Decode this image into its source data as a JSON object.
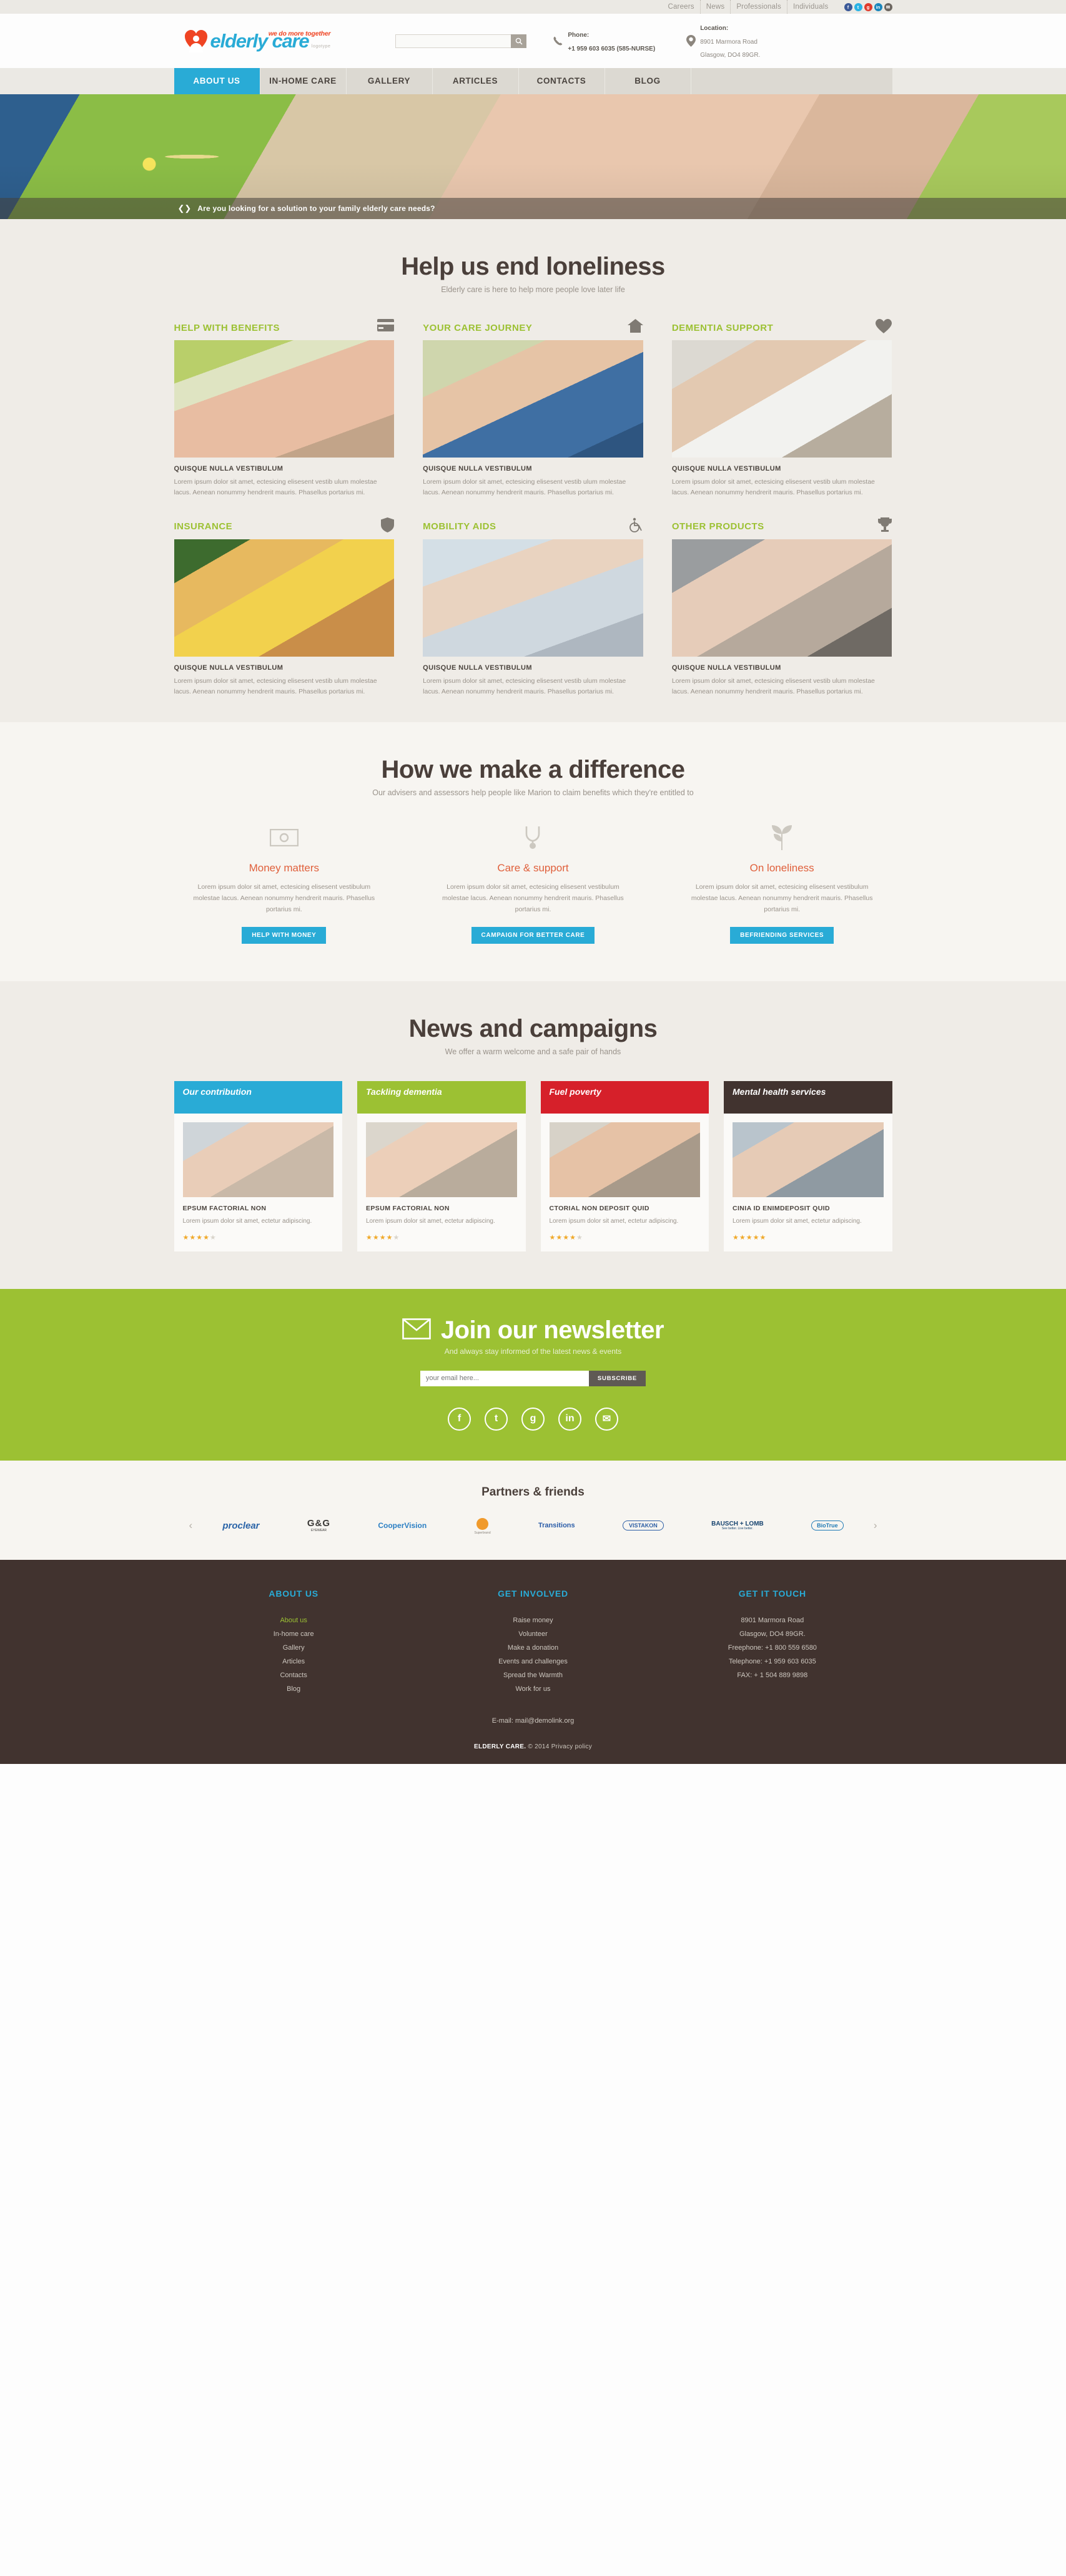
{
  "topbar": {
    "links": [
      "Careers",
      "News",
      "Professionals",
      "Individuals"
    ],
    "social": [
      {
        "name": "facebook-icon",
        "glyph": "f"
      },
      {
        "name": "twitter-icon",
        "glyph": "t"
      },
      {
        "name": "google-plus-icon",
        "glyph": "g"
      },
      {
        "name": "linkedin-icon",
        "glyph": "in"
      },
      {
        "name": "mail-icon",
        "glyph": "✉"
      }
    ]
  },
  "header": {
    "logo_main": "elderly care",
    "logo_tagline": "we do more together",
    "logo_sub": "logotype",
    "search_placeholder": "",
    "search_value": "",
    "phone_label": "Phone:",
    "phone_value": "+1 959 603 6035 (585-NURSE)",
    "location_label": "Location:",
    "location_line1": "8901 Marmora Road",
    "location_line2": "Glasgow, DO4 89GR."
  },
  "nav": {
    "items": [
      {
        "label": "ABOUT US",
        "active": true
      },
      {
        "label": "IN-HOME CARE",
        "active": false
      },
      {
        "label": "GALLERY",
        "active": false
      },
      {
        "label": "ARTICLES",
        "active": false
      },
      {
        "label": "CONTACTS",
        "active": false
      },
      {
        "label": "BLOG",
        "active": false
      }
    ]
  },
  "hero": {
    "caption": "Are you looking for a solution to your family elderly care needs?"
  },
  "services": {
    "title": "Help us end loneliness",
    "subtitle": "Elderly care is here to help more people love later life",
    "card_subtitle": "QUISQUE NULLA VESTIBULUM",
    "card_text": "Lorem ipsum dolor sit amet, ectesicing elisesent vestib ulum molestae lacus. Aenean nonummy hendrerit mauris. Phasellus portarius mi.",
    "items": [
      {
        "title": "HELP WITH BENEFITS",
        "icon": "credit-card-icon"
      },
      {
        "title": "YOUR CARE JOURNEY",
        "icon": "home-icon"
      },
      {
        "title": "DEMENTIA SUPPORT",
        "icon": "heart-icon"
      },
      {
        "title": "INSURANCE",
        "icon": "shield-icon"
      },
      {
        "title": "MOBILITY AIDS",
        "icon": "wheelchair-icon"
      },
      {
        "title": "OTHER PRODUCTS",
        "icon": "trophy-icon"
      }
    ]
  },
  "difference": {
    "title": "How we make a difference",
    "subtitle": "Our advisers and assessors help people like Marion to claim benefits which they're entitled to",
    "items": [
      {
        "icon": "banknote-icon",
        "title": "Money matters",
        "text": "Lorem ipsum dolor sit amet, ectesicing elisesent vestibulum molestae lacus. Aenean nonummy hendrerit mauris. Phasellus portarius mi.",
        "button": "HELP WITH MONEY"
      },
      {
        "icon": "stethoscope-icon",
        "title": "Care & support",
        "text": "Lorem ipsum dolor sit amet, ectesicing elisesent vestibulum molestae lacus. Aenean nonummy hendrerit mauris. Phasellus portarius mi.",
        "button": "CAMPAIGN FOR BETTER CARE"
      },
      {
        "icon": "leaf-icon",
        "title": "On loneliness",
        "text": "Lorem ipsum dolor sit amet, ectesicing elisesent vestibulum molestae lacus. Aenean nonummy hendrerit mauris. Phasellus portarius mi.",
        "button": "BEFRIENDING SERVICES"
      }
    ]
  },
  "news": {
    "title": "News and campaigns",
    "subtitle": "We offer a warm welcome and a safe pair of hands",
    "items": [
      {
        "caption": "Our contribution",
        "caption_color": "#29abd6",
        "title": "EPSUM FACTORIAL NON",
        "text": "Lorem ipsum dolor sit amet, ectetur adipiscing.",
        "stars": 4
      },
      {
        "caption": "Tackling dementia",
        "caption_color": "#9cc133",
        "title": "EPSUM FACTORIAL NON",
        "text": "Lorem ipsum dolor sit amet, ectetur adipiscing.",
        "stars": 4
      },
      {
        "caption": "Fuel poverty",
        "caption_color": "#d6202a",
        "title": "CTORIAL NON DEPOSIT QUID",
        "text": "Lorem ipsum dolor sit amet, ectetur adipiscing.",
        "stars": 4
      },
      {
        "caption": "Mental health services",
        "caption_color": "#41332f",
        "title": "CINIA ID ENIMDEPOSIT QUID",
        "text": "Lorem ipsum dolor sit amet, ectetur adipiscing.",
        "stars": 5
      }
    ]
  },
  "newsletter": {
    "title": "Join our newsletter",
    "subtitle": "And always stay informed of the latest news & events",
    "input_placeholder": "your email here...",
    "button": "SUBSCRIBE",
    "social": [
      {
        "name": "facebook-icon",
        "glyph": "f"
      },
      {
        "name": "twitter-icon",
        "glyph": "t"
      },
      {
        "name": "google-plus-icon",
        "glyph": "g"
      },
      {
        "name": "linkedin-icon",
        "glyph": "in"
      },
      {
        "name": "mail-icon",
        "glyph": "✉"
      }
    ]
  },
  "partners": {
    "title": "Partners & friends",
    "prev": "‹",
    "next": "›",
    "items": [
      "proclear",
      "G&G",
      "CooperVision",
      "SuperBrands",
      "Transitions",
      "VISTAKON",
      "BAUSCH + LOMB",
      "BioTrue"
    ],
    "gg_sub": "EYEWEAR",
    "bausch_sub": "See better. Live better.",
    "superb_sub": "Superbrand"
  },
  "footer": {
    "columns": [
      {
        "heading": "ABOUT US",
        "links": [
          "About us",
          "In-home care",
          "Gallery",
          "Articles",
          "Contacts",
          "Blog"
        ],
        "current": "About us"
      },
      {
        "heading": "GET INVOLVED",
        "links": [
          "Raise money",
          "Volunteer",
          "Make a donation",
          "Events and challenges",
          "Spread the Warmth",
          "Work for us"
        ],
        "current": ""
      },
      {
        "heading": "GET IT TOUCH",
        "links": [
          "8901 Marmora Road",
          "Glasgow, DO4 89GR.",
          "Freephone:  +1 800 559 6580",
          "Telephone:  +1 959 603 6035",
          "FAX:          + 1 504 889 9898"
        ],
        "current": ""
      }
    ],
    "email": "E-mail: mail@demolink.org",
    "copyright_brand": "ELDERLY CARE.",
    "copyright_rest": " © 2014 Privacy policy"
  }
}
